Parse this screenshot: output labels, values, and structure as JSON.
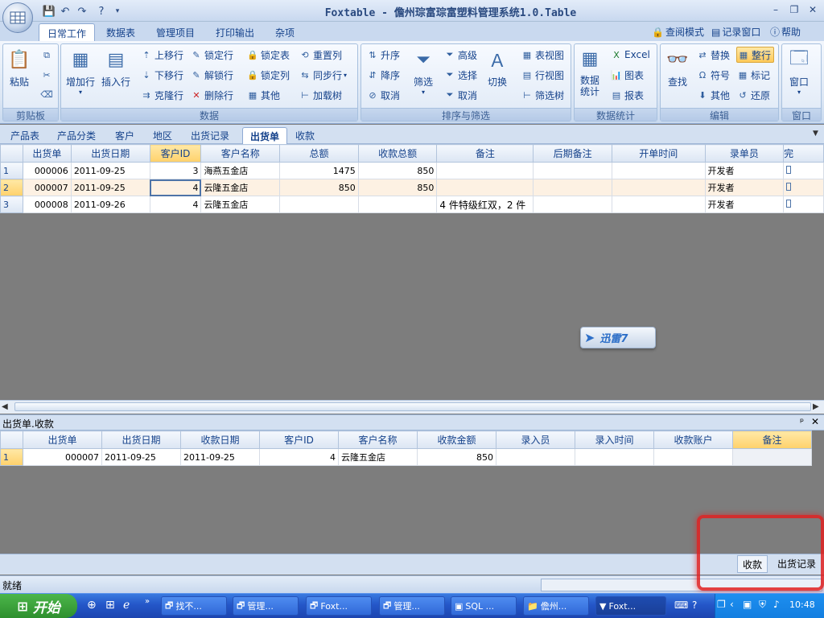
{
  "window": {
    "title": "Foxtable - 儋州琮富琮富塑料管理系统1.0.Table",
    "minimize": "–",
    "restore": "❐",
    "close": "✕"
  },
  "ribbon_tabs": [
    "日常工作",
    "数据表",
    "管理项目",
    "打印输出",
    "杂项"
  ],
  "ribbon_links": {
    "view_mode": "查阅模式",
    "record_window": "记录窗口",
    "help": "帮助"
  },
  "groups": {
    "clipboard": {
      "title": "剪贴板",
      "paste": "粘贴"
    },
    "data": {
      "title": "数据",
      "add_row": "增加行",
      "insert_row": "插入行",
      "move_up": "上移行",
      "move_down": "下移行",
      "clone_row": "克隆行",
      "lock_row": "锁定行",
      "unlock_row": "解锁行",
      "delete_row": "删除行",
      "lock_table": "锁定表",
      "lock_col": "锁定列",
      "other": "其他",
      "reset_col": "重置列",
      "sync_row": "同步行",
      "load_tree": "加载树"
    },
    "sort_filter": {
      "title": "排序与筛选",
      "asc": "升序",
      "desc": "降序",
      "cancel": "取消",
      "filter": "筛选",
      "advanced": "高级",
      "select": "选择",
      "cancel2": "取消",
      "switch": "切换",
      "table_view": "表视图",
      "row_view": "行视图",
      "filter_tree": "筛选树"
    },
    "stats": {
      "title": "数据统计",
      "data_stats": "数据\n统计",
      "excel": "Excel",
      "chart": "图表",
      "report": "报表"
    },
    "edit": {
      "title": "编辑",
      "find": "查找",
      "replace": "替换",
      "symbol": "符号",
      "other": "其他",
      "whole_row": "整行",
      "mark": "标记",
      "restore": "还原"
    },
    "window_group": {
      "title": "窗口",
      "window": "窗口"
    }
  },
  "table_tabs": [
    "产品表",
    "产品分类",
    "客户",
    "地区",
    "出货记录",
    "出货单",
    "收款"
  ],
  "active_table_tab": 5,
  "main_grid": {
    "columns": [
      "出货单",
      "出货日期",
      "客户ID",
      "客户名称",
      "总额",
      "收款总额",
      "备注",
      "后期备注",
      "开单时间",
      "录单员",
      "完"
    ],
    "rows": [
      {
        "num": "1",
        "cells": [
          "000006",
          "2011-09-25",
          "3",
          "海燕五金店",
          "1475",
          "850",
          "",
          "",
          "",
          "开发者",
          ""
        ]
      },
      {
        "num": "2",
        "cells": [
          "000007",
          "2011-09-25",
          "4",
          "云隆五金店",
          "850",
          "850",
          "",
          "",
          "",
          "开发者",
          ""
        ]
      },
      {
        "num": "3",
        "cells": [
          "000008",
          "2011-09-26",
          "4",
          "云隆五金店",
          "",
          "",
          "4 件特级红双，2 件",
          "",
          "",
          "开发者",
          ""
        ]
      }
    ]
  },
  "watermark": "迅雷7",
  "sub_panel": {
    "title": "出货单.收款",
    "pin": "ᵖ",
    "close": "✕"
  },
  "sub_grid": {
    "columns": [
      "出货单",
      "出货日期",
      "收款日期",
      "客户ID",
      "客户名称",
      "收款金额",
      "录入员",
      "录入时间",
      "收款账户",
      "备注"
    ],
    "rows": [
      {
        "num": "1",
        "cells": [
          "000007",
          "2011-09-25",
          "2011-09-25",
          "4",
          "云隆五金店",
          "850",
          "",
          "",
          "",
          ""
        ]
      }
    ]
  },
  "bottom_tabs": [
    "收款",
    "出货记录"
  ],
  "status": "就绪",
  "taskbar": {
    "start": "开始",
    "buttons": [
      "找不...",
      "管理...",
      "Foxt...",
      "管理...",
      "SQL ...",
      "儋州...",
      "Foxt..."
    ],
    "clock": "10:48"
  },
  "colors": {
    "accent": "#15428b",
    "highlight": "#ffd16b",
    "taskbar": "#2456c8",
    "redbox": "#e02020"
  }
}
